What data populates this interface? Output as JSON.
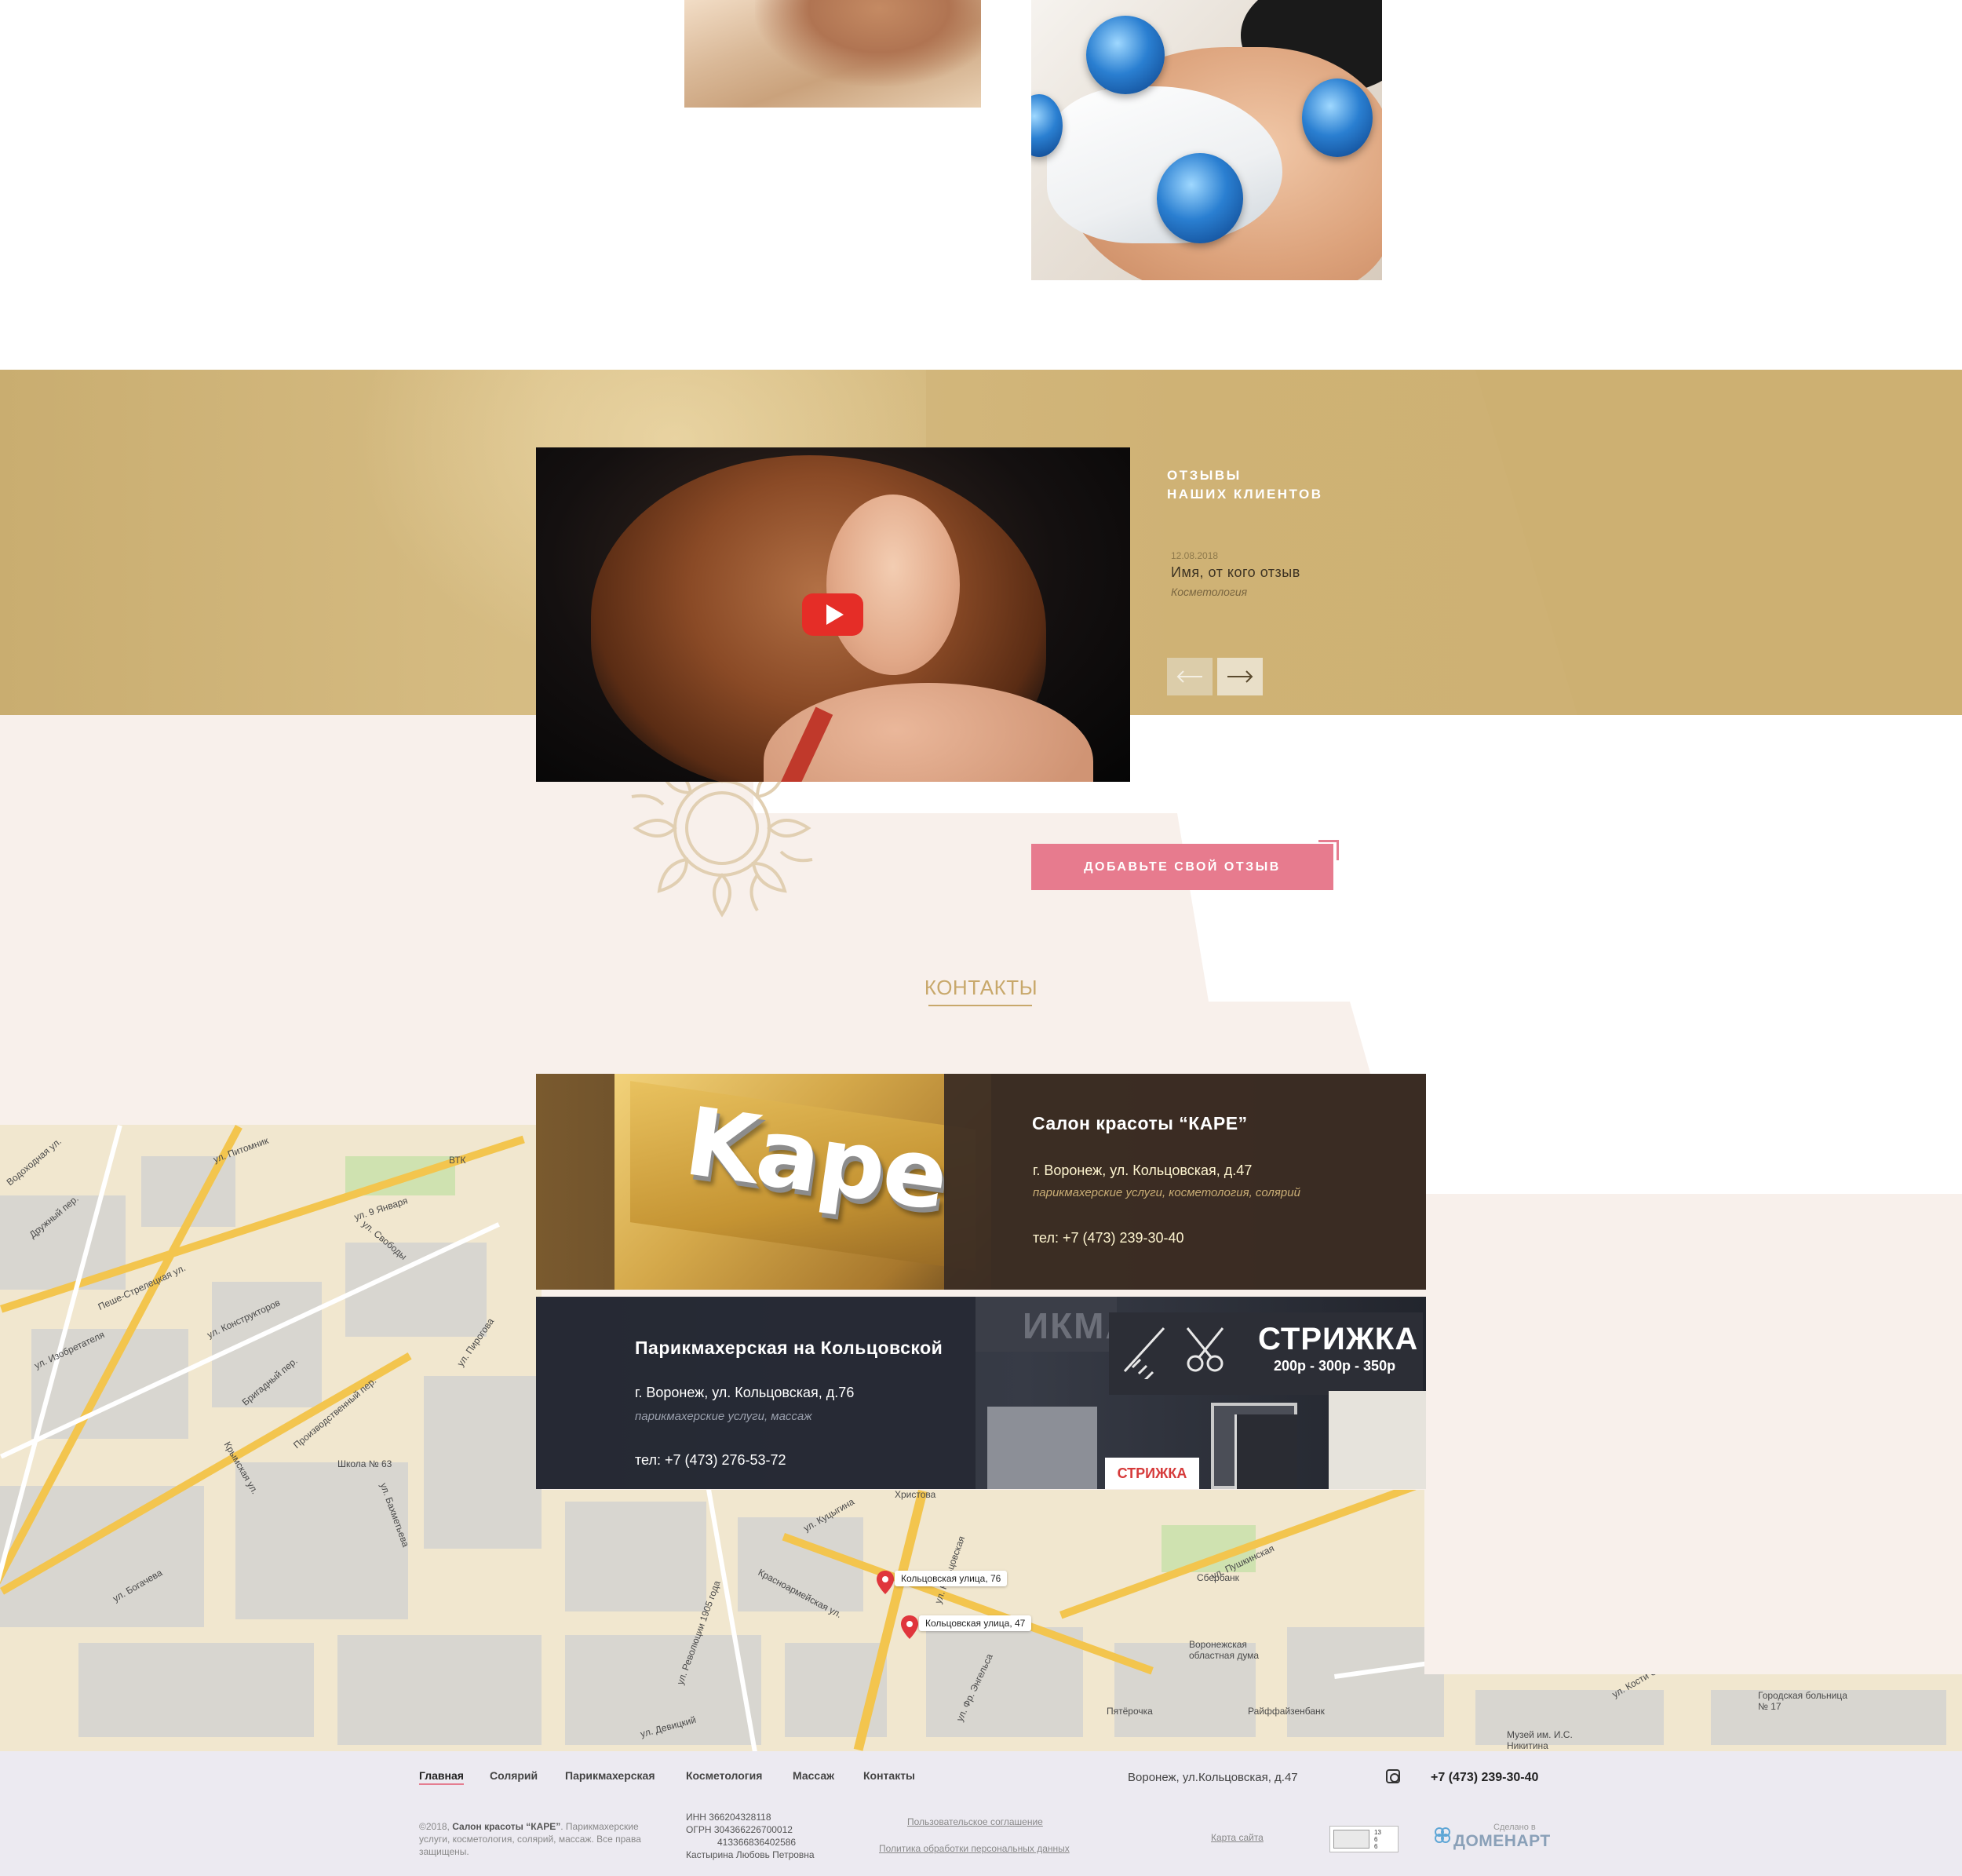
{
  "reviews": {
    "title_line1": "ОТЗЫВЫ",
    "title_line2": "НАШИХ КЛИЕНТОВ",
    "date": "12.08.2018",
    "name": "Имя, от кого отзыв",
    "category": "Косметология",
    "add_button": "ДОБАВЬТЕ СВОЙ ОТЗЫВ"
  },
  "contacts": {
    "title": "КОНТАКТЫ",
    "salon1": {
      "sign": "Kape",
      "title": "Салон красоты “КАРЕ”",
      "address": "г. Воронеж, ул. Кольцовская, д.47",
      "services": "парикмахерские услуги, косметология, солярий",
      "phone": "тел: +7 (473) 239-30-40"
    },
    "salon2": {
      "title": "Парикмахерская на Кольцовской",
      "address": "г. Воронеж, ул. Кольцовская, д.76",
      "services": "парикмахерские услуги, массаж",
      "phone": "тел: +7 (473) 276-53-72",
      "shop_sign": "СТРИЖКА",
      "shop_prices": "200р - 300р - 350р",
      "shop_ghost": "ИКМАХЕРСКАЯ",
      "shop_mini_sign": "СТРИЖКА"
    }
  },
  "map": {
    "pin1": "Кольцовская улица, 76",
    "pin2": "Кольцовская улица, 47",
    "streets": [
      "ул. Питомник",
      "ул. 9 Января",
      "ул. Свободы",
      "Пеше-Стрелецкая ул.",
      "ул. Конструкторов",
      "ул. Изобретателя",
      "Бригадный пер.",
      "Производственный пер.",
      "ул. Пирогова",
      "Школа № 63",
      "ул. Бахметьева",
      "ул. Богачева",
      "Крымская ул.",
      "Дружный пер.",
      "ул. Кольцовская",
      "Красноармейская ул.",
      "ул. Куцыгина",
      "ул. Пушкинская",
      "Сбербанк",
      "Воронежская областная дума",
      "ул. Революции 1905 года",
      "Пятёрочка",
      "Райффайзенбанк",
      "Христова",
      "ВТК",
      "Городская больница № 17",
      "Музей им. И.С. Никитина",
      "ул. Фр. Энгельса",
      "ул. Девицкий",
      "ул. Кости Стр.",
      "Водоходная ул."
    ]
  },
  "footer": {
    "nav": [
      "Главная",
      "Солярий",
      "Парикмахерская",
      "Косметология",
      "Массаж",
      "Контакты"
    ],
    "address": "Воронеж, ул.Кольцовская, д.47",
    "phone": "+7 (473) 239-30-40",
    "copyright_prefix": "©2018, ",
    "copyright_name": "Салон красоты “КАРЕ”",
    "copyright_rest": ". Парикмахерские услуги, косметология, солярий, массаж. Все права защищены.",
    "inn": "ИНН 366204328118",
    "ogrn": "ОГРН 304366226700012",
    "ogrn2": "413366836402586",
    "owner": "Кастырина Любовь Петровна",
    "user_agreement": "Пользовательское соглашение",
    "privacy": "Политика обработки персональных данных",
    "sitemap": "Карта сайта",
    "counter_nums": [
      "13",
      "6",
      "6"
    ],
    "made_in": "Сделано в",
    "developer": "ДОМЕНАРТ"
  },
  "colors": {
    "gold": "#cfb275",
    "pink": "#e77b8e",
    "beige": "#f8f0eb",
    "dark_card": "#3a2c24",
    "footer_bg": "#eceaf1"
  }
}
